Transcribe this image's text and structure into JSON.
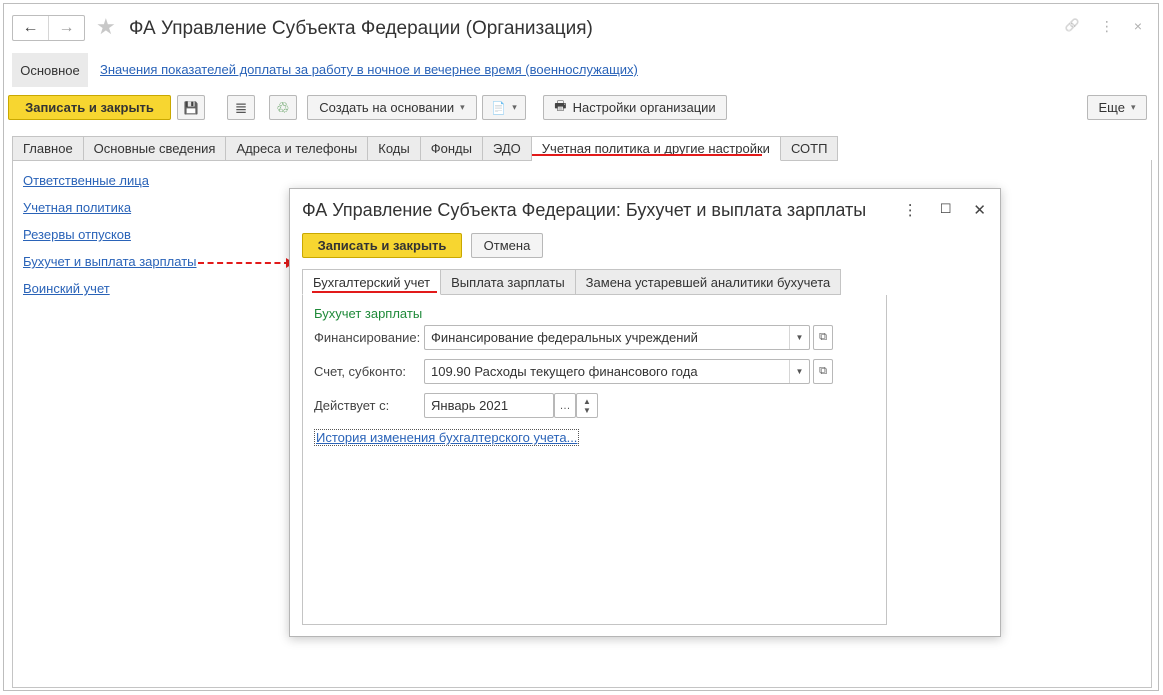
{
  "window": {
    "title": "ФА Управление Субъекта Федерации (Организация)",
    "back_icon": "←",
    "forward_icon": "→",
    "star_icon": "★",
    "link_icon": "🔗",
    "more_icon": "⋮",
    "close_icon": "×"
  },
  "subnav": {
    "active": "Основное",
    "link": "Значения показателей доплаты за работу в ночное и вечернее время (военнослужащих)"
  },
  "toolbar": {
    "save_close": "Записать и закрыть",
    "save_icon": "💾",
    "list_icon": "≣",
    "struct_icon": "♲",
    "create_based": "Создать на основании",
    "docs_icon": "📄",
    "org_settings": "Настройки организации",
    "printer_icon": "🖶",
    "more": "Еще"
  },
  "tabs": [
    "Главное",
    "Основные сведения",
    "Адреса и телефоны",
    "Коды",
    "Фонды",
    "ЭДО",
    "Учетная политика и другие настройки",
    "СОТП"
  ],
  "side_links": [
    "Ответственные лица",
    "Учетная политика",
    "Резервы отпусков",
    "Бухучет и выплата зарплаты",
    "Воинский учет"
  ],
  "dialog": {
    "title": "ФА Управление Субъекта Федерации: Бухучет и выплата зарплаты",
    "more_icon": "⋮",
    "maximize_icon": "☐",
    "close_icon": "✕",
    "save_close": "Записать и закрыть",
    "cancel": "Отмена",
    "tabs": [
      "Бухгалтерский учет",
      "Выплата зарплаты",
      "Замена устаревшей аналитики бухучета"
    ],
    "group_title": "Бухучет зарплаты",
    "financing_label": "Финансирование:",
    "financing_value": "Финансирование федеральных учреждений",
    "account_label": "Счет, субконто:",
    "account_value": "109.90 Расходы текущего финансового года",
    "valid_from_label": "Действует с:",
    "valid_from_value": "Январь 2021",
    "history_link": "История изменения бухгалтерского учета..."
  },
  "colors": {
    "accent_yellow": "#f7d630",
    "link_blue": "#2a63b8",
    "annotation_red": "#e21a1a",
    "group_green": "#1f8a3a"
  }
}
